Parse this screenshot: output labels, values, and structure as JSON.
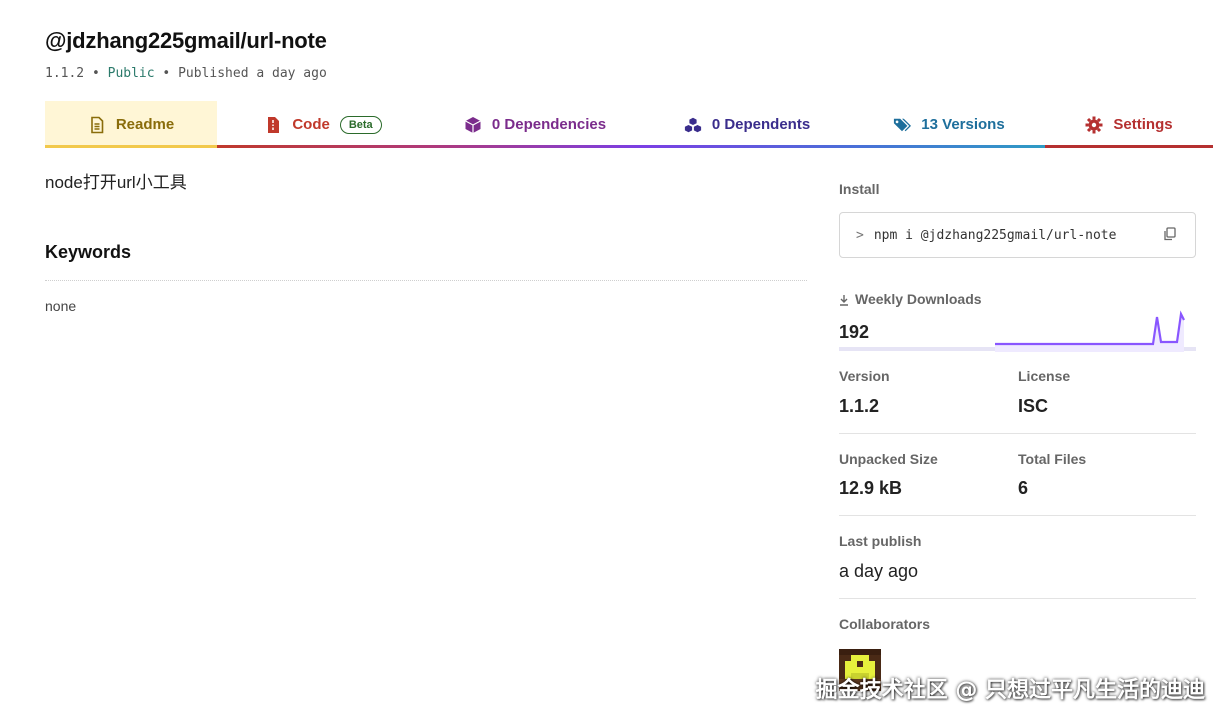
{
  "package": {
    "name": "@jdzhang225gmail/url-note",
    "version": "1.1.2",
    "visibility": "Public",
    "published": "Published a day ago",
    "separator": "•"
  },
  "tabs": [
    {
      "label": "Readme",
      "icon": "readme-icon",
      "active": true
    },
    {
      "label": "Code",
      "icon": "code-icon",
      "badge": "Beta"
    },
    {
      "label": "0 Dependencies",
      "icon": "dependencies-icon"
    },
    {
      "label": "0 Dependents",
      "icon": "dependents-icon"
    },
    {
      "label": "13 Versions",
      "icon": "versions-icon"
    },
    {
      "label": "Settings",
      "icon": "settings-icon"
    }
  ],
  "readme": {
    "text": "node打开url小工具",
    "keywords_heading": "Keywords",
    "keywords_value": "none"
  },
  "sidebar": {
    "install_label": "Install",
    "install_chevron": ">",
    "install_command": "npm i @jdzhang225gmail/url-note",
    "weekly_downloads_label": "Weekly Downloads",
    "weekly_downloads": "192",
    "version_label": "Version",
    "version": "1.1.2",
    "license_label": "License",
    "license": "ISC",
    "unpacked_size_label": "Unpacked Size",
    "unpacked_size": "12.9 kB",
    "total_files_label": "Total Files",
    "total_files": "6",
    "last_publish_label": "Last publish",
    "last_publish": "a day ago",
    "collaborators_label": "Collaborators"
  },
  "colors": {
    "readme_tab": "#8a6d0b",
    "code_tab": "#c0392b",
    "deps_tab": "#7b2c8c",
    "dependents_tab": "#3a2d8c",
    "versions_tab": "#1e6f9c",
    "settings_tab": "#b53030",
    "sparkline": "#8956ff"
  },
  "watermark": "掘金技术社区 @ 只想过平凡生活的迪迪"
}
